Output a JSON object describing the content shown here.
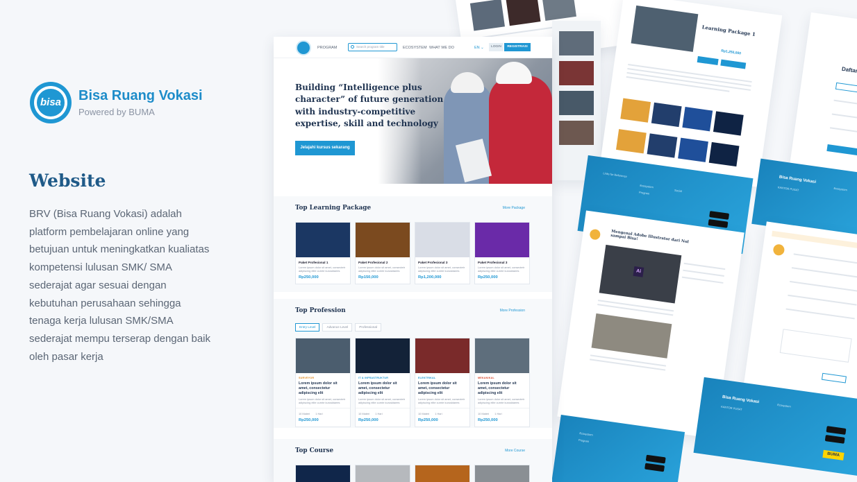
{
  "brand": {
    "logo_text": "bisa",
    "name": "Bisa Ruang Vokasi",
    "tagline": "Powered by BUMA"
  },
  "section": {
    "title": "Website",
    "description": "BRV (Bisa Ruang Vokasi) adalah platform pembelajaran online yang betujuan untuk meningkatkan kualiatas kompetensi lulusan SMK/ SMA sederajat agar sesuai dengan kebutuhan perusahaan sehingga tenaga kerja lulusan SMK/SMA sederajat mempu terserap dengan baik oleh pasar kerja"
  },
  "site": {
    "nav": {
      "program": "PROGRAM",
      "search_placeholder": "Search program title",
      "ecosystem": "ECOSYSTEM",
      "what_we_do": "WHAT WE DO",
      "lang": "EN ⌄",
      "login": "LOGIN",
      "register": "REGISTRASI"
    },
    "hero": {
      "title": "Building “Intelligence plus character” of future generation with industry-competitive expertise, skill and technology",
      "cta": "Jelajahi kursus sekarang"
    },
    "packages": {
      "title": "Top Learning Package",
      "more": "More Package",
      "items": [
        {
          "name": "Paket Profesional 1",
          "text": "Lorem ipsum dolor sit amet, consectetr adipiscing elite curnte kurusktaees",
          "price": "Rp250,000",
          "color": "#1b3763"
        },
        {
          "name": "Paket Profesional 2",
          "text": "Lorem ipsum dolor sit amet, consectetr adipiscing elite curnte kurusktaees",
          "price": "Rp150,000",
          "color": "#7b4a1f"
        },
        {
          "name": "Paket Profesional 3",
          "text": "Lorem ipsum dolor sit amet, consectetr adipiscing elite curnte kurusktaees",
          "price": "Rp1,200,000",
          "color": "#d9dde6"
        },
        {
          "name": "Paket Profesional 3",
          "text": "Lorem ipsum dolor sit amet, consectetr adipiscing elite curnte kurusktaees",
          "price": "Rp250,000",
          "color": "#6a2aa8"
        }
      ]
    },
    "professions": {
      "title": "Top Profession",
      "more": "More Profession",
      "tabs": [
        "Entry Level",
        "Advance Level",
        "Professional"
      ],
      "items": [
        {
          "category": "SURVEYOR",
          "cat_color": "#e08a1e",
          "title": "Lorem ipsum dolor sit amet, consectetur adipiscing elit",
          "text": "Lorem ipsum dolor sit amet, consectetr adipiscing elite curnte kurusktaees",
          "materials": "10 Materi",
          "duration": "1 Hari",
          "price": "Rp250,000",
          "color": "#4b5d6e"
        },
        {
          "category": "IT & INFRASTRUKTUR",
          "cat_color": "#1f97d3",
          "title": "Lorem ipsum dolor sit amet, consectetur adipiscing elit",
          "text": "Lorem ipsum dolor sit amet, consectetr adipiscing elite curnte kurusktaees",
          "materials": "10 Materi",
          "duration": "1 Hari",
          "price": "Rp250,000",
          "color": "#132238"
        },
        {
          "category": "ELEKTRIKAL",
          "cat_color": "#1f97d3",
          "title": "Lorem ipsum dolor sit amet, consectetur adipiscing elit",
          "text": "Lorem ipsum dolor sit amet, consectetr adipiscing elite curnte kurusktaees",
          "materials": "10 Materi",
          "duration": "1 Hari",
          "price": "Rp250,000",
          "color": "#7a2a2a"
        },
        {
          "category": "MEKANIKAL",
          "cat_color": "#d9482b",
          "title": "Lorem ipsum dolor sit amet, consectetur adipiscing elit",
          "text": "Lorem ipsum dolor sit amet, consectetr adipiscing elite curnte kurusktaees",
          "materials": "10 Materi",
          "duration": "1 Hari",
          "price": "Rp250,000",
          "color": "#5e6e7c"
        }
      ]
    },
    "courses": {
      "title": "Top Course",
      "more": "More Course",
      "colors": [
        "#10264a",
        "#b6b9bd",
        "#b5651d",
        "#8a8f94"
      ]
    }
  },
  "background": {
    "detail_title": "Learning Package 1",
    "detail_price": "Rp1,250,000",
    "footer_brand": "Bisa Ruang Vokasi",
    "video_title": "Mengenal Adobe Illustrator dari Nol sampai Bisa!",
    "register_title": "Daftar",
    "footer_brand_2": "Bisa Ruang Vokasi",
    "buma": "BUMA"
  }
}
